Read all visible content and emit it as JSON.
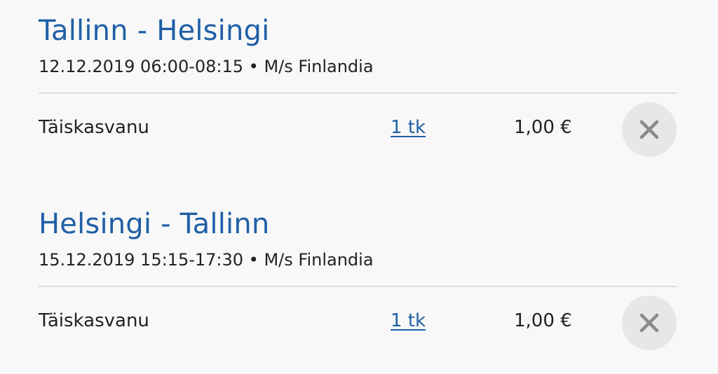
{
  "trips": [
    {
      "title": "Tallinn - Helsingi",
      "date_time": "12.12.2019 06:00-08:15",
      "separator": "•",
      "ship": "M/s Finlandia",
      "ticket": {
        "type": "Täiskasvanu",
        "quantity": "1 tk",
        "price": "1,00 €"
      }
    },
    {
      "title": "Helsingi - Tallinn",
      "date_time": "15.12.2019 15:15-17:30",
      "separator": "•",
      "ship": "M/s Finlandia",
      "ticket": {
        "type": "Täiskasvanu",
        "quantity": "1 tk",
        "price": "1,00 €"
      }
    }
  ],
  "icons": {
    "remove": "close-icon"
  },
  "colors": {
    "title": "#1f5fa6",
    "link": "#1f5fa6",
    "remove_bg": "#e7e7e7",
    "remove_icon": "#8a8a8a",
    "divider": "#dddddd"
  }
}
